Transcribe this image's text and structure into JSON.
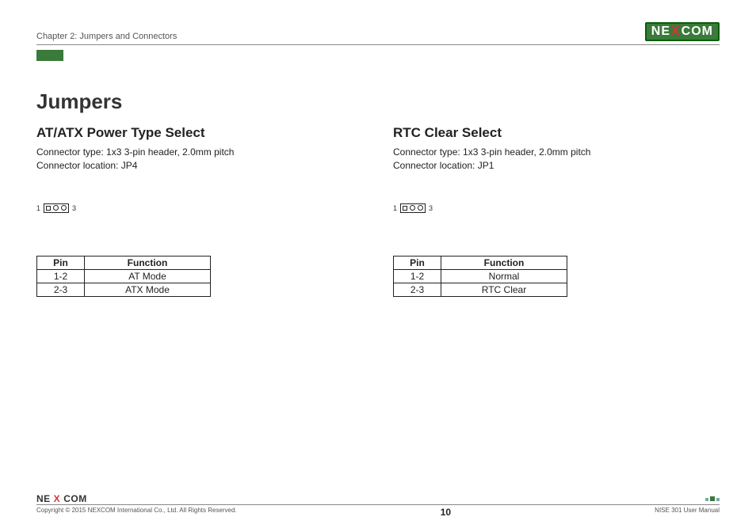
{
  "header": {
    "chapter": "Chapter 2: Jumpers and Connectors",
    "logo_text_pre": "NE",
    "logo_text_x": "X",
    "logo_text_post": "COM"
  },
  "page": {
    "title": "Jumpers"
  },
  "sections": [
    {
      "title": "AT/ATX Power Type Select",
      "connector_type": "Connector type: 1x3 3-pin header, 2.0mm pitch",
      "connector_location": "Connector location: JP4",
      "pin_left": "1",
      "pin_right": "3",
      "table": {
        "headers": [
          "Pin",
          "Function"
        ],
        "rows": [
          [
            "1-2",
            "AT Mode"
          ],
          [
            "2-3",
            "ATX Mode"
          ]
        ]
      }
    },
    {
      "title": "RTC Clear Select",
      "connector_type": "Connector type: 1x3 3-pin header, 2.0mm pitch",
      "connector_location": "Connector location: JP1",
      "pin_left": "1",
      "pin_right": "3",
      "table": {
        "headers": [
          "Pin",
          "Function"
        ],
        "rows": [
          [
            "1-2",
            "Normal"
          ],
          [
            "2-3",
            "RTC Clear"
          ]
        ]
      }
    }
  ],
  "footer": {
    "logo_pre": "NE",
    "logo_x": "X",
    "logo_post": "COM",
    "copyright": "Copyright © 2015 NEXCOM International Co., Ltd. All Rights Reserved.",
    "page_number": "10",
    "manual": "NISE 301 User Manual"
  }
}
